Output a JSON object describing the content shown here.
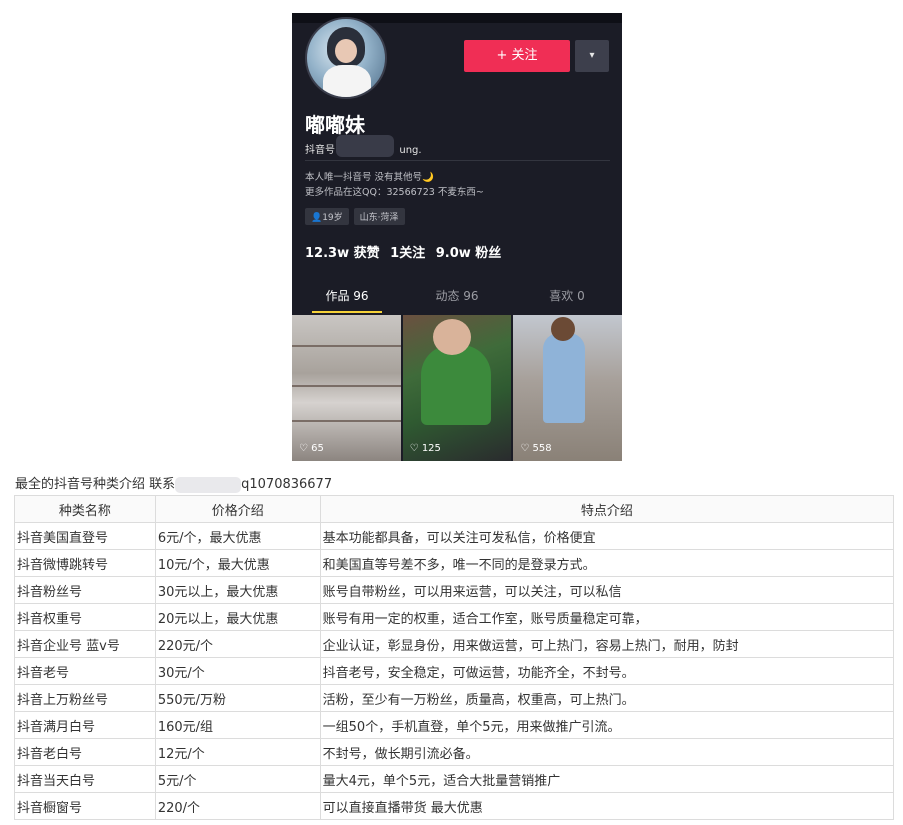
{
  "profile": {
    "follow_label": "+ 关注",
    "dropdown_icon": "▾",
    "nickname": "嘟嘟妹",
    "douyin_id_prefix": "抖音号",
    "douyin_id_suffix": "ung.",
    "bio_line1": "本人唯一抖音号 没有其他号🌙",
    "bio_line2": "更多作品在这QQ：32566723 不麦东西~",
    "tags": [
      "👤19岁",
      "山东·菏泽"
    ],
    "stats": {
      "likes": "12.3w 获赞",
      "following": "1关注",
      "fans": "9.0w 粉丝"
    },
    "tabs": [
      "作品 96",
      "动态 96",
      "喜欢 0"
    ],
    "videos": [
      {
        "likes": "♡ 65"
      },
      {
        "likes": "♡ 125"
      },
      {
        "likes": "♡ 558"
      }
    ]
  },
  "heading": {
    "prefix": "最全的抖音号种类介绍 联系",
    "suffix": "q1070836677"
  },
  "table": {
    "headers": [
      "种类名称",
      "价格介绍",
      "特点介绍"
    ],
    "rows": [
      [
        "抖音美国直登号",
        "6元/个，最大优惠",
        "基本功能都具备，可以关注可发私信，价格便宜"
      ],
      [
        "抖音微博跳转号",
        "10元/个，最大优惠",
        "和美国直等号差不多，唯一不同的是登录方式。"
      ],
      [
        "抖音粉丝号",
        "30元以上，最大优惠",
        "账号自带粉丝，可以用来运营，可以关注，可以私信"
      ],
      [
        "抖音权重号",
        "20元以上，最大优惠",
        "账号有用一定的权重，适合工作室，账号质量稳定可靠，"
      ],
      [
        "抖音企业号 蓝v号",
        "220元/个",
        "企业认证，彰显身份，用来做运营，可上热门，容易上热门，耐用，防封"
      ],
      [
        "抖音老号",
        "30元/个",
        "抖音老号，安全稳定，可做运营，功能齐全，不封号。"
      ],
      [
        "抖音上万粉丝号",
        "550元/万粉",
        "活粉，至少有一万粉丝，质量高，权重高，可上热门。"
      ],
      [
        "抖音满月白号",
        "160元/组",
        "一组50个，手机直登，单个5元，用来做推广引流。"
      ],
      [
        "抖音老白号",
        "12元/个",
        "不封号，做长期引流必备。"
      ],
      [
        "抖音当天白号",
        "5元/个",
        "量大4元，单个5元，适合大批量营销推广"
      ],
      [
        "抖音橱窗号",
        "220/个",
        "可以直接直播带货 最大优惠"
      ]
    ]
  }
}
